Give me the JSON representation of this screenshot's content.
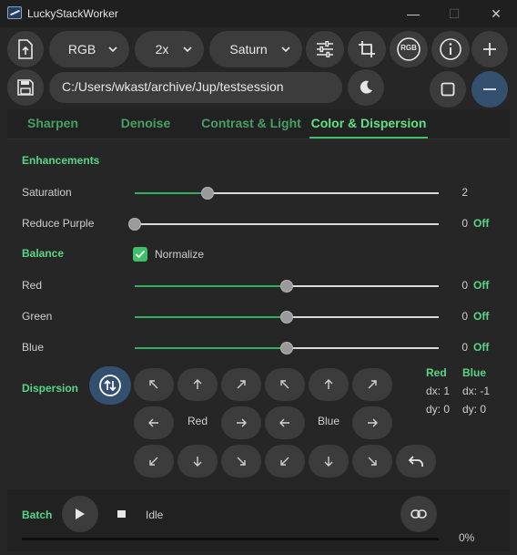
{
  "window": {
    "title": "LuckyStackWorker",
    "controls": {
      "minimize": "—",
      "maximize": "☐",
      "close": "✕"
    }
  },
  "toolbar": {
    "color_mode": "RGB",
    "scale": "2x",
    "planet": "Saturn",
    "path": "C:/Users/wkast/archive/Jup/testsession",
    "rgb_badge": "RGB"
  },
  "tabs": [
    {
      "label": "Sharpen",
      "active": false
    },
    {
      "label": "Denoise",
      "active": false
    },
    {
      "label": "Contrast & Light",
      "active": false
    },
    {
      "label": "Color & Dispersion",
      "active": true
    }
  ],
  "enhancements": {
    "title": "Enhancements",
    "saturation": {
      "label": "Saturation",
      "value": "2",
      "fraction": 0.24
    },
    "reduce_purple": {
      "label": "Reduce Purple",
      "value": "0",
      "status": "Off",
      "fraction": 0.0
    }
  },
  "balance": {
    "title": "Balance",
    "normalize_label": "Normalize",
    "normalize_checked": true,
    "red": {
      "label": "Red",
      "value": "0",
      "status": "Off",
      "fraction": 0.5
    },
    "green": {
      "label": "Green",
      "value": "0",
      "status": "Off",
      "fraction": 0.5
    },
    "blue": {
      "label": "Blue",
      "value": "0",
      "status": "Off",
      "fraction": 0.5
    }
  },
  "dispersion": {
    "title": "Dispersion",
    "red_center_label": "Red",
    "blue_center_label": "Blue",
    "red": {
      "label": "Red",
      "dx": "dx: 1",
      "dy": "dy: 0"
    },
    "blue": {
      "label": "Blue",
      "dx": "dx: -1",
      "dy": "dy: 0"
    }
  },
  "batch": {
    "title": "Batch",
    "status": "Idle",
    "progress_text": "0%",
    "progress_fraction": 0.0
  },
  "colors": {
    "accent_green": "#58d685",
    "slider_fill": "#32b05f",
    "accent_blue": "#34506f",
    "background": "#262626"
  }
}
